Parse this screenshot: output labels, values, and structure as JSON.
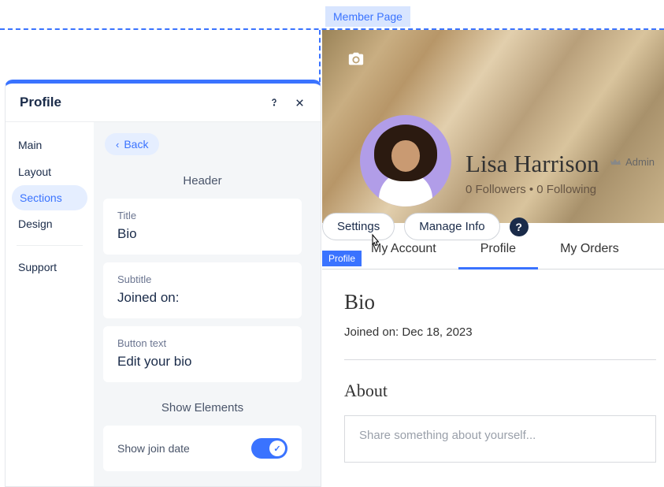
{
  "canvas": {
    "member_tag": "Member Page",
    "profile_tag": "Profile"
  },
  "panel": {
    "title": "Profile",
    "nav": {
      "main": "Main",
      "layout": "Layout",
      "sections": "Sections",
      "design": "Design",
      "support": "Support"
    },
    "back_label": "Back",
    "section_header": "Header",
    "fields": {
      "title_label": "Title",
      "title_value": "Bio",
      "subtitle_label": "Subtitle",
      "subtitle_value": "Joined on:",
      "button_label": "Button text",
      "button_value": "Edit your bio"
    },
    "show_elements_heading": "Show Elements",
    "show_join_date_label": "Show join date"
  },
  "preview": {
    "display_name": "Lisa Harrison",
    "admin_label": "Admin",
    "stats": "0 Followers • 0 Following",
    "actions": {
      "settings": "Settings",
      "manage_info": "Manage Info",
      "help": "?"
    },
    "tabs": {
      "my_account": "My Account",
      "profile": "Profile",
      "my_orders": "My Orders",
      "my": "My"
    },
    "bio": {
      "heading": "Bio",
      "joined_line": "Joined on: Dec 18, 2023",
      "about_heading": "About",
      "about_placeholder": "Share something about yourself..."
    }
  }
}
